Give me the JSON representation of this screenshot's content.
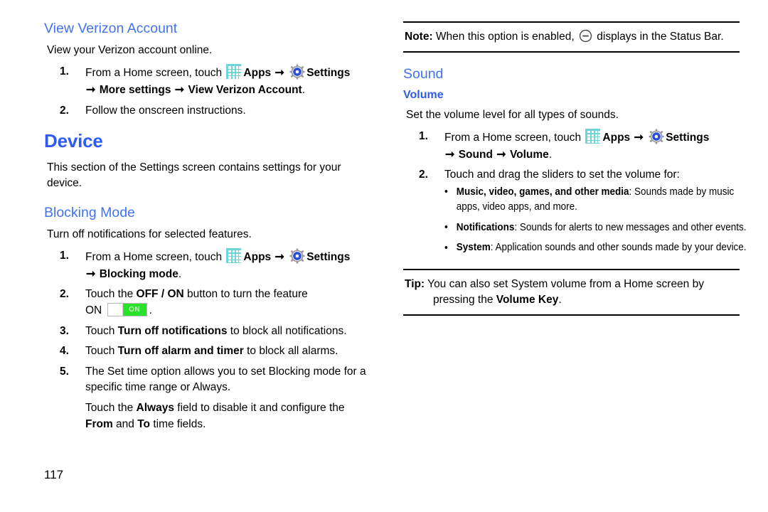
{
  "colors": {
    "heading_blue": "#4272EE",
    "heading_blue_bold": "#2F5BEF",
    "apps_icon_teal": "#6FD4D8",
    "gear_blue": "#2B4FD8",
    "toggle_green": "#2BE22B"
  },
  "left_column": {
    "section_view_verizon": {
      "heading": "View Verizon Account",
      "intro": "View your Verizon account online.",
      "steps": [
        {
          "number": "1.",
          "line1_a": "From a Home screen, touch",
          "apps_label": "Apps",
          "settings_label": "Settings",
          "line2_a": "More settings",
          "line2_b": "View Verizon Account",
          "line2_end": "."
        },
        {
          "number": "2.",
          "text": "Follow the onscreen instructions."
        }
      ]
    },
    "section_device": {
      "heading": "Device",
      "intro": "This section of the Settings screen contains settings for your device."
    },
    "section_blocking_mode": {
      "heading": "Blocking Mode",
      "intro": "Turn off notifications for selected features.",
      "steps": [
        {
          "number": "1.",
          "line1_a": "From a Home screen, touch",
          "apps_label": "Apps",
          "settings_label": "Settings",
          "line2_b": "Blocking mode",
          "line2_end": "."
        },
        {
          "number": "2.",
          "text_a": "Touch the ",
          "text_bold": "OFF / ON",
          "text_b": " button to turn the feature",
          "text_c": "ON",
          "toggle_label": "ON",
          "text_end": "."
        },
        {
          "number": "3.",
          "text_a": "Touch ",
          "text_bold": "Turn off notifications",
          "text_b": " to block all notifications."
        },
        {
          "number": "4.",
          "text_a": "Touch ",
          "text_bold": "Turn off alarm and timer",
          "text_b": " to block all alarms."
        },
        {
          "number": "5.",
          "text_a": "The Set time option allows you to set Blocking mode for a specific time range or Always.",
          "para2_a": "Touch the ",
          "para2_bold1": "Always",
          "para2_b": " field to disable it and configure the ",
          "para2_bold2": "From",
          "para2_c": " and ",
          "para2_bold3": "To",
          "para2_d": " time fields."
        }
      ]
    },
    "page_number": "117"
  },
  "right_column": {
    "note": {
      "label": "Note:",
      "text_a": " When this option is enabled, ",
      "icon": "circle-minus-icon",
      "text_b": " displays in the Status Bar."
    },
    "section_sound": {
      "heading": "Sound",
      "subheading": "Volume",
      "intro": "Set the volume level for all types of sounds.",
      "steps": [
        {
          "number": "1.",
          "line1_a": "From a Home screen, touch",
          "apps_label": "Apps",
          "settings_label": "Settings",
          "line2_a": "Sound",
          "line2_b": "Volume",
          "line2_end": "."
        },
        {
          "number": "2.",
          "text": "Touch and drag the sliders to set the volume for:",
          "bullets": [
            {
              "bold": "Music, video, games, and other media",
              "rest": ": Sounds made by music apps, video apps, and more."
            },
            {
              "bold": "Notifications",
              "rest": ": Sounds for alerts to new messages and other events."
            },
            {
              "bold": "System",
              "rest": ": Application sounds and other sounds made by your device."
            }
          ]
        }
      ]
    },
    "tip": {
      "label": "Tip:",
      "text_a": " You can also set System volume from a Home screen by pressing the ",
      "text_bold": "Volume Key",
      "text_end": "."
    }
  }
}
